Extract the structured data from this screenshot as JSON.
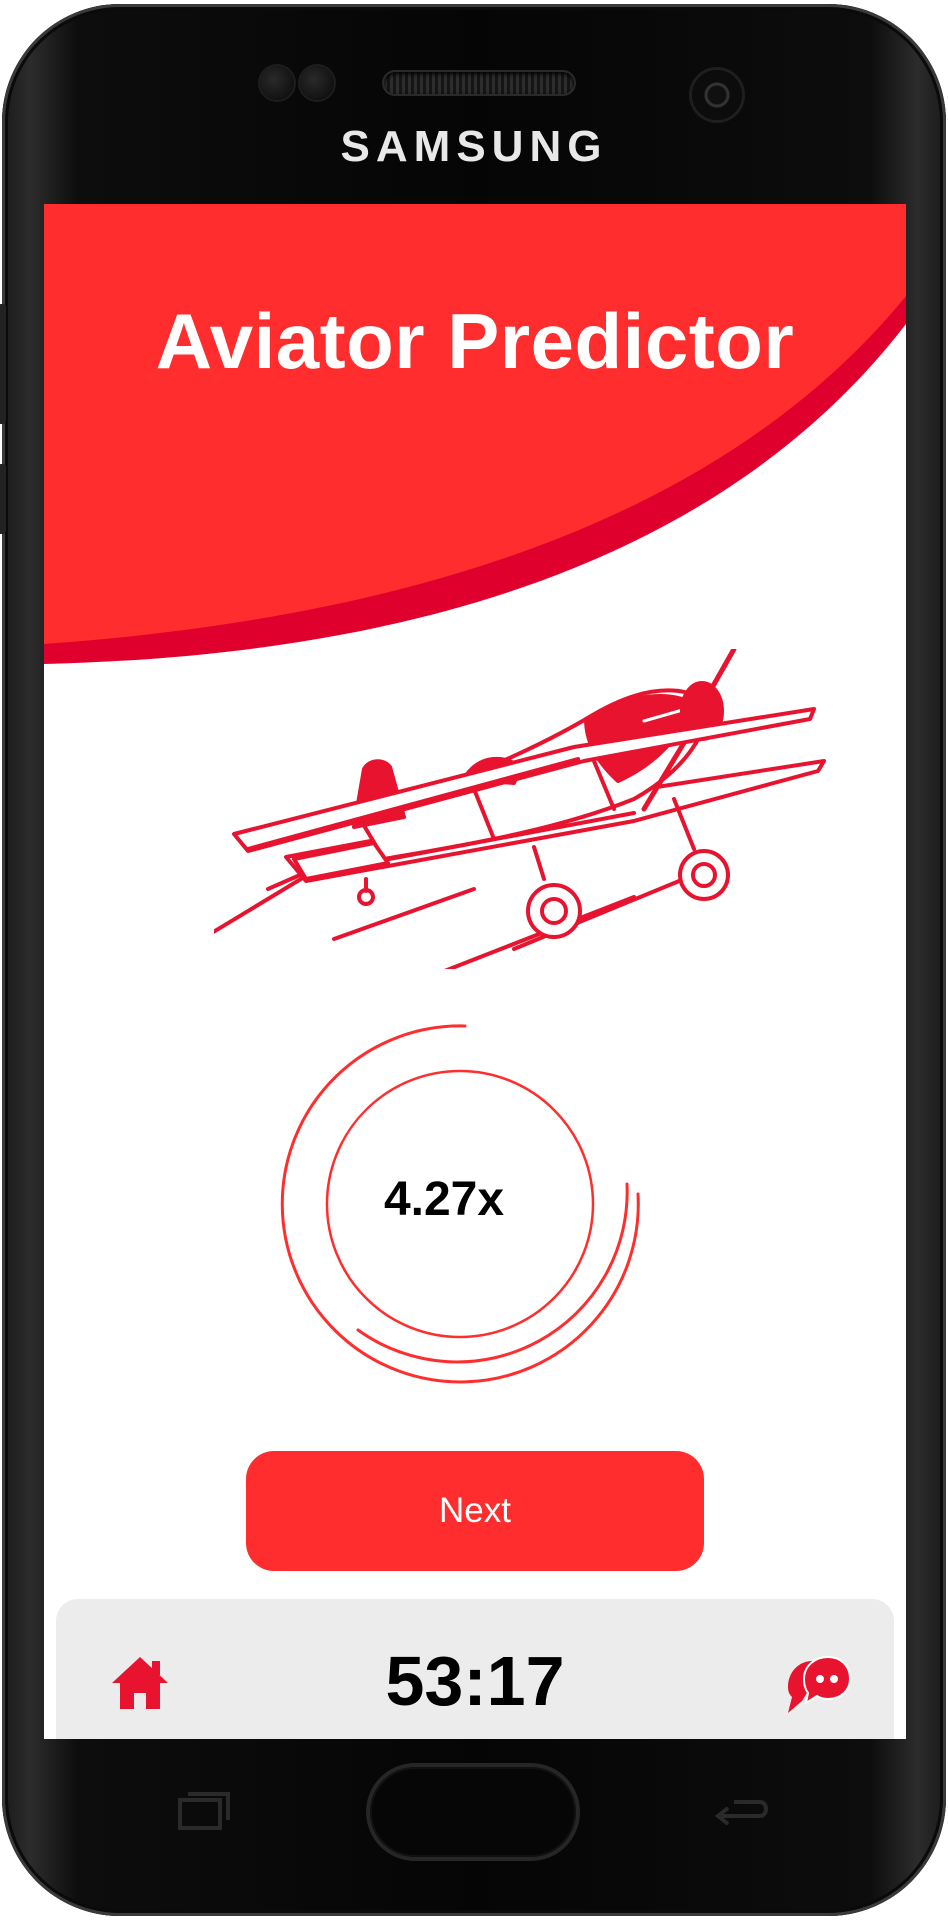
{
  "device": {
    "brand": "SAMSUNG"
  },
  "app": {
    "title": "Aviator Predictor",
    "multiplier": "4.27x",
    "next_label": "Next",
    "timer": "53:17"
  },
  "colors": {
    "primary": "#ff2d2d",
    "accent_dark": "#e0002e",
    "bar_bg": "#ececec"
  },
  "icons": {
    "home": "home-icon",
    "chat": "chat-icon",
    "plane": "airplane-illustration"
  }
}
